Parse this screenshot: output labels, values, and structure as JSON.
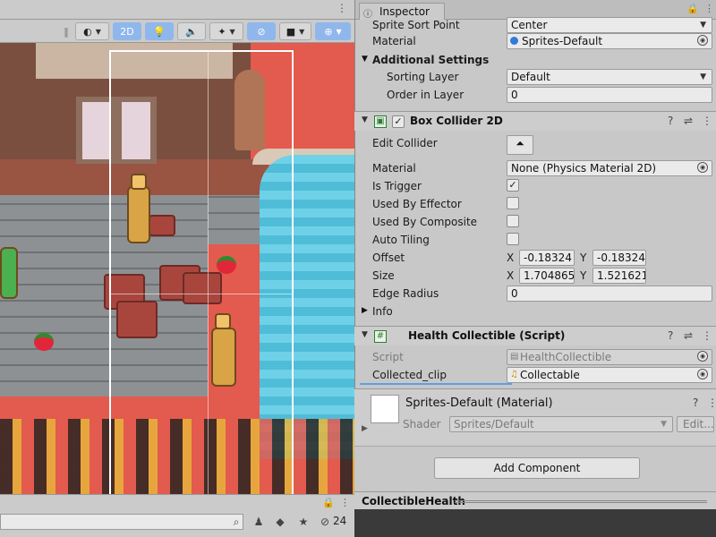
{
  "scene": {
    "toolbar": {
      "mode_2d": "2D"
    },
    "bottom": {
      "hidden_count": "24"
    }
  },
  "inspector": {
    "tab_label": "Inspector",
    "sprite_renderer": {
      "sprite_sort_point_label": "Sprite Sort Point",
      "sprite_sort_point_value": "Center",
      "material_label": "Material",
      "material_value": "Sprites-Default",
      "additional_settings_label": "Additional Settings",
      "sorting_layer_label": "Sorting Layer",
      "sorting_layer_value": "Default",
      "order_in_layer_label": "Order in Layer",
      "order_in_layer_value": "0"
    },
    "box_collider": {
      "title": "Box Collider 2D",
      "edit_collider_label": "Edit Collider",
      "material_label": "Material",
      "material_value": "None (Physics Material 2D)",
      "is_trigger_label": "Is Trigger",
      "is_trigger": true,
      "used_by_effector_label": "Used By Effector",
      "used_by_effector": false,
      "used_by_composite_label": "Used By Composite",
      "used_by_composite": false,
      "auto_tiling_label": "Auto Tiling",
      "auto_tiling": false,
      "offset_label": "Offset",
      "offset_x": "-0.18324",
      "offset_y": "-0.18324",
      "size_label": "Size",
      "size_x": "1.704865",
      "size_y": "1.521621",
      "edge_radius_label": "Edge Radius",
      "edge_radius_value": "0",
      "info_label": "Info",
      "axis_x": "X",
      "axis_y": "Y"
    },
    "health_collectible": {
      "title": "Health Collectible (Script)",
      "script_label": "Script",
      "script_value": "HealthCollectible",
      "collected_clip_label": "Collected_clip",
      "collected_clip_value": "Collectable"
    },
    "material": {
      "title": "Sprites-Default (Material)",
      "shader_label": "Shader",
      "shader_value": "Sprites/Default",
      "edit_label": "Edit..."
    },
    "add_component_label": "Add Component",
    "preview_title": "CollectibleHealth"
  },
  "colors": {
    "scene_ground": "#e35a4e",
    "water": "#6fd1e7",
    "toolbar_active": "#8fb7ec",
    "panel_bg": "#c8c8c8"
  }
}
